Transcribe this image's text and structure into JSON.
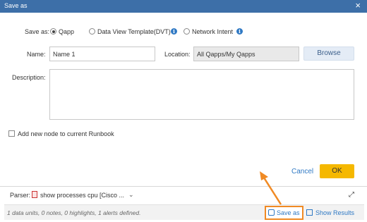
{
  "dialog": {
    "title": "Save as",
    "close_glyph": "×"
  },
  "save_as": {
    "label": "Save as:",
    "options": [
      {
        "label": "Qapp",
        "checked": true
      },
      {
        "label": "Data View Template(DVT)",
        "checked": false,
        "info": true
      },
      {
        "label": "Network Intent",
        "checked": false,
        "info": true
      }
    ],
    "info_glyph": "i"
  },
  "name": {
    "label": "Name:",
    "value": "Name 1"
  },
  "location": {
    "label": "Location:",
    "value": "All Qapps/My Qapps",
    "browse_label": "Browse"
  },
  "description": {
    "label": "Description:",
    "value": ""
  },
  "runbook": {
    "label": "Add new node to current Runbook",
    "checked": false
  },
  "actions": {
    "cancel_label": "Cancel",
    "ok_label": "OK",
    "ok_color": "#f5b800"
  },
  "parser": {
    "label": "Parser:",
    "value": "show processes cpu [Cisco ...",
    "chevron": "⌄",
    "expand_glyph": "⤢"
  },
  "footer": {
    "summary": "1 data units, 0 notes, 0 highlights, 1 alerts defined.",
    "save_as_label": "Save as",
    "show_results_label": "Show Results"
  },
  "colors": {
    "titlebar": "#3d6fa8",
    "link": "#2f79c4",
    "highlight": "#f08a24"
  }
}
